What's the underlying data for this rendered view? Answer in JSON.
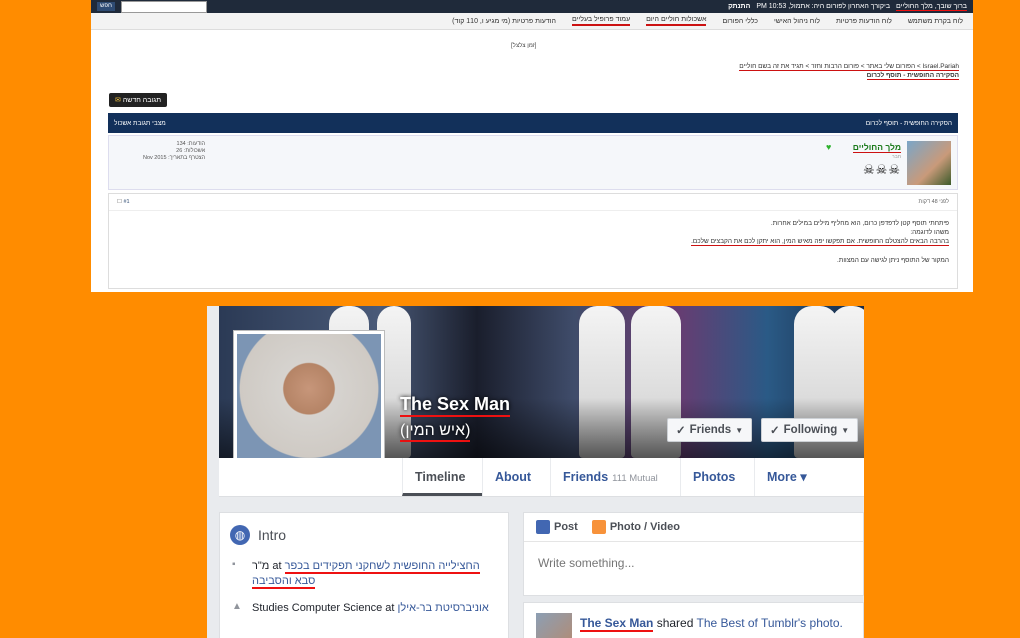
{
  "forum": {
    "topbar_user": "ברוך שובך, מלך החוליים",
    "topbar_info": "ביקורך האחרון לפורום היה: אתמול, PM 10:53",
    "topbar_logout": "התנתק",
    "topbar_go": "חפש",
    "nav": [
      {
        "label": "לוח בקרת משתמש",
        "underline": false
      },
      {
        "label": "לוח הודעות פרטיות",
        "underline": false
      },
      {
        "label": "לוח ניהול האישי",
        "underline": false
      },
      {
        "label": "כללי הפורום",
        "underline": false
      },
      {
        "label": "אשכולות חוליים היום",
        "underline": true
      },
      {
        "label": "עמוד פרופיל בעליים",
        "underline": true
      },
      {
        "label": "הודעות פרטיות (מי מגיע ו, 110 קוד)",
        "underline": false
      }
    ],
    "tiny_link": "[זמן צלצל]",
    "breadcrumb": "Israel.Pariah > הפורום שלי באתר > פורום הרבות וחזר > תגיד את זה בשם חוליים",
    "thread_title": "הסקירה החופשית - תוסף לכרום",
    "new_reply": "תגובה חדשה",
    "postbar_title": "הסקירה החופשית - תוסף לכרום",
    "postbar_right": "מצבי תגובת אשכול",
    "user_name": "מלך החוליים",
    "user_title": "חבר",
    "user_badges": "☠☠☠",
    "user_stats": [
      "הודעות: 134",
      "אשכולות: 26",
      "הצטרף בתאריך: Nov 2015"
    ],
    "post_time": "לפני 48 דקות",
    "post_number": "#1",
    "post_lines": [
      {
        "text": "פיתחתי תוסף קטן לדפדפן כרום, הוא מחליף מילים במילים אחרות.",
        "underline": false
      },
      {
        "text": "משהו לדוגמה:",
        "underline": false
      },
      {
        "text": "בהרבה הבאים להצטלם החופשית. אם תפקשו יפה מאיש המין, הוא יתקן לכם את הקבצים שלכם.",
        "underline": true
      },
      {
        "text": "המקור של התוסף ניתן לגישה עם המצוות.",
        "underline": false
      }
    ]
  },
  "facebook": {
    "profile_name": "The Sex Man",
    "alt_name": "(איש המין)",
    "friends_btn": "Friends",
    "following_btn": "Following",
    "tabs": [
      {
        "label": "Timeline",
        "sub": ""
      },
      {
        "label": "About",
        "sub": ""
      },
      {
        "label": "Friends",
        "sub": "111 Mutual"
      },
      {
        "label": "Photos",
        "sub": ""
      },
      {
        "label": "More ▾",
        "sub": ""
      }
    ],
    "intro_title": "Intro",
    "intro_rows": [
      {
        "prefix": "מ\"ר at",
        "value": "החצילייה החופשית לשחקני תפקידים בכפר סבא והסביבה",
        "icon": "briefcase-icon"
      },
      {
        "prefix": "Studies Computer Science at",
        "value": "אוניברסיטת בר-אילן",
        "icon": "graduation-cap-icon"
      }
    ],
    "composer_post": "Post",
    "composer_photo": "Photo / Video",
    "composer_placeholder": "Write something...",
    "feed_name": "The Sex Man",
    "feed_action": " shared ",
    "feed_target": "The Best of Tumblr's photo."
  },
  "colors": {
    "background": "#ff8c00",
    "fb_blue": "#365899",
    "underline_red": "#e11111",
    "forum_header": "#12305a"
  }
}
